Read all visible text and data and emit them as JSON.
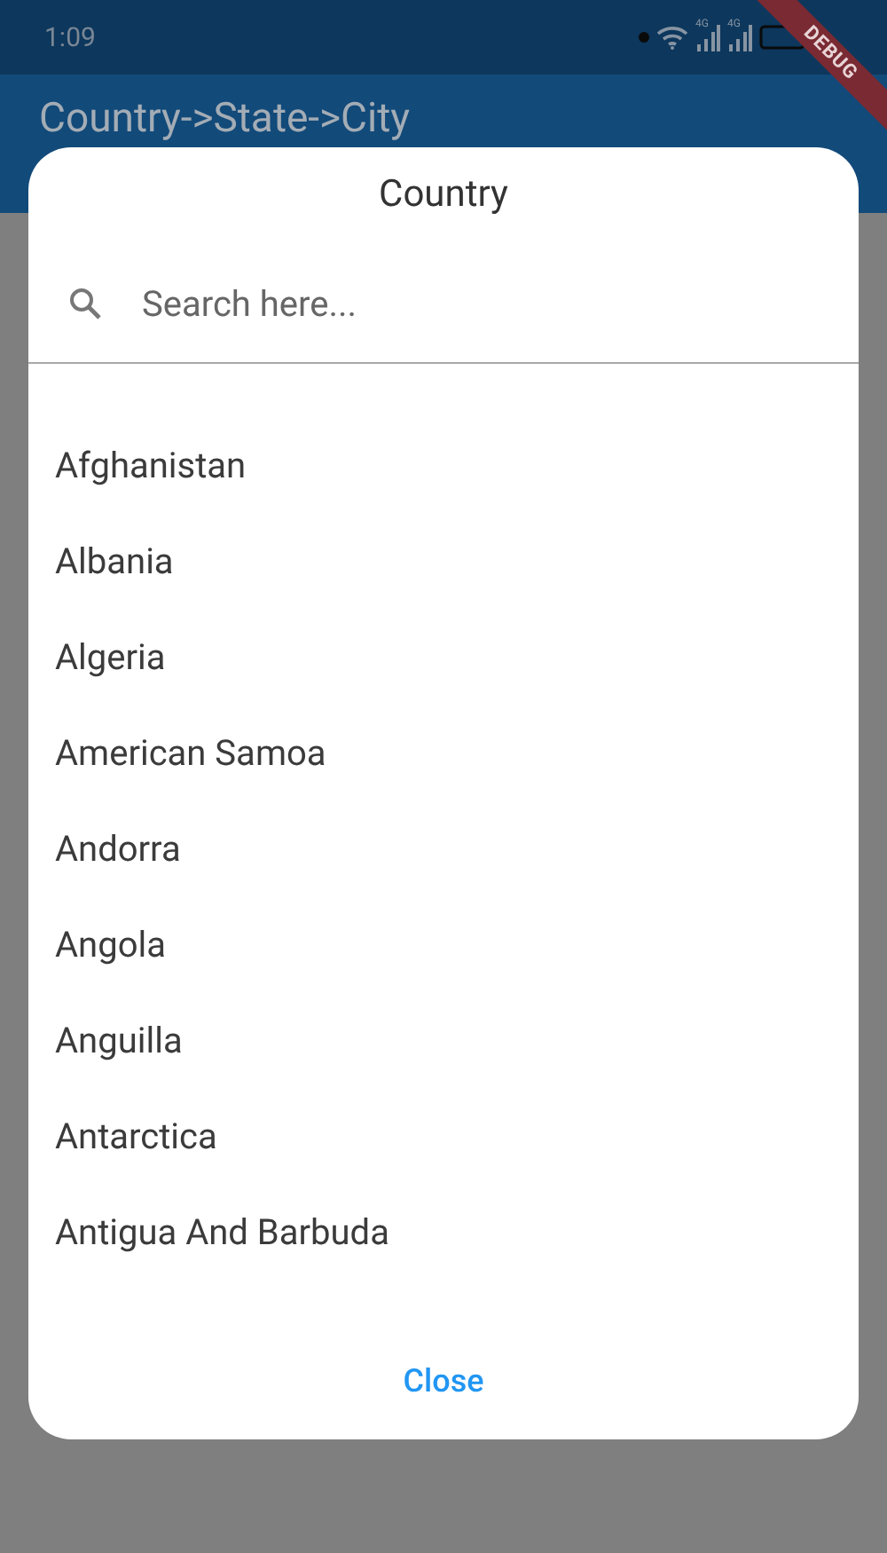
{
  "status_bar": {
    "time": "1:09",
    "network_labels": [
      "4G",
      "4G"
    ]
  },
  "debug_banner": "DEBUG",
  "app_bar": {
    "title": "Country->State->City"
  },
  "dialog": {
    "title": "Country",
    "search": {
      "placeholder": "Search here..."
    },
    "items": [
      "Afghanistan",
      "Albania",
      "Algeria",
      "American Samoa",
      "Andorra",
      "Angola",
      "Anguilla",
      "Antarctica",
      "Antigua And Barbuda"
    ],
    "close_button": "Close"
  }
}
